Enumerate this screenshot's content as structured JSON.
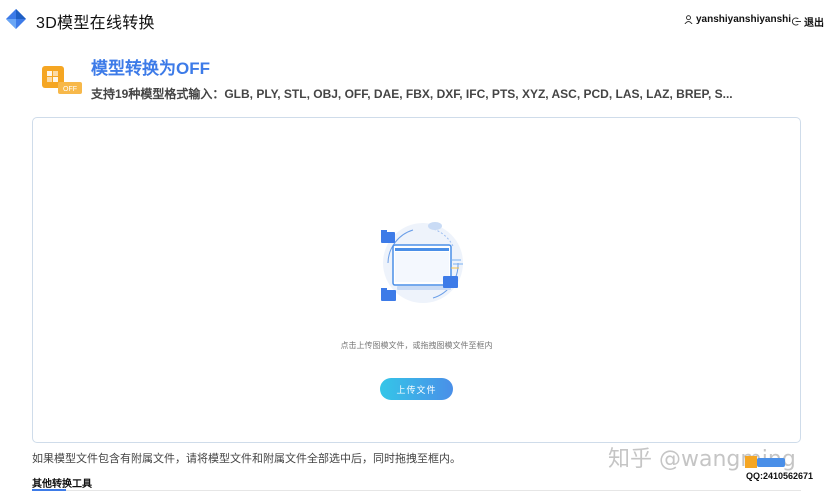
{
  "header": {
    "app_title": "3D模型在线转换",
    "username": "yanshiyanshiyanshi",
    "logout_label": "退出"
  },
  "tool": {
    "title": "模型转换为OFF",
    "subtitle": "支持19种模型格式输入：GLB, PLY, STL, OBJ, OFF, DAE, FBX, DXF, IFC, PTS, XYZ, ASC, PCD, LAS, LAZ, BREP, S...",
    "icon_badge": "OFF"
  },
  "upload": {
    "hint": "点击上传图模文件，或拖拽图模文件至框内",
    "button_label": "上传文件"
  },
  "notice": "如果模型文件包含有附属文件，请将模型文件和附属文件全部选中后，同时拖拽至框内。",
  "other_tools_label": "其他转换工具",
  "watermark": {
    "text": "知乎 @wangming",
    "qq": "QQ:2410562671"
  },
  "colors": {
    "accent": "#3d7be8",
    "button_start": "#34c6e8",
    "button_end": "#4a8fe8",
    "icon_orange": "#f5a623"
  }
}
